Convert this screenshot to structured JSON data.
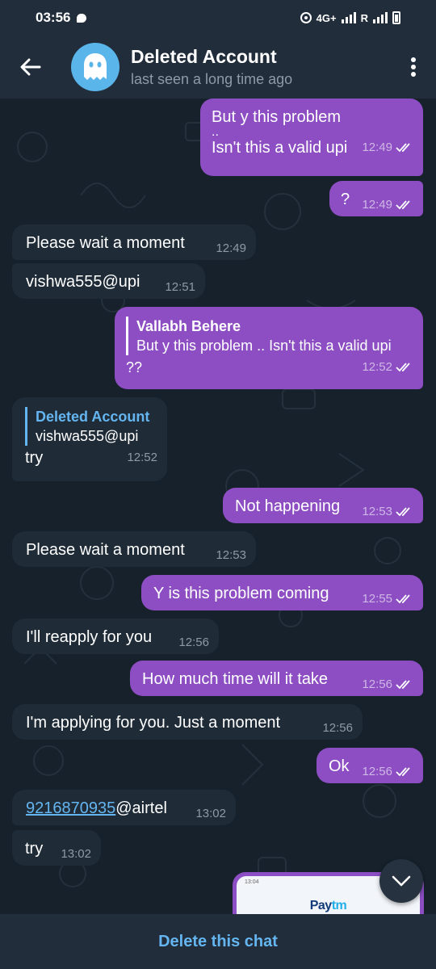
{
  "status_bar": {
    "time": "03:56",
    "network": "4G+",
    "roaming": "R"
  },
  "header": {
    "title": "Deleted Account",
    "subtitle": "last seen a long time ago"
  },
  "messages": [
    {
      "dir": "out",
      "lines": [
        "But y this problem",
        "..",
        "Isn't this a valid upi"
      ],
      "time": "12:49"
    },
    {
      "dir": "out",
      "text": "?",
      "time": "12:49"
    },
    {
      "dir": "in",
      "text": "Please wait a moment",
      "time": "12:49"
    },
    {
      "dir": "in",
      "text": "vishwa555@upi",
      "time": "12:51"
    },
    {
      "dir": "out",
      "reply_name": "Vallabh Behere",
      "reply_text": "But y this problem .. Isn't this a valid upi",
      "text": "??",
      "time": "12:52"
    },
    {
      "dir": "in",
      "reply_name": "Deleted Account",
      "reply_text": "vishwa555@upi",
      "text": "try",
      "time": "12:52"
    },
    {
      "dir": "out",
      "text": "Not happening",
      "time": "12:53"
    },
    {
      "dir": "in",
      "text": "Please wait a moment",
      "time": "12:53"
    },
    {
      "dir": "out",
      "text": "Y is this problem coming",
      "time": "12:55"
    },
    {
      "dir": "in",
      "text": "I'll reapply for you",
      "time": "12:56"
    },
    {
      "dir": "out",
      "text": "How much time will it take",
      "time": "12:56"
    },
    {
      "dir": "in",
      "text": "I'm applying for you. Just a moment",
      "time": "12:56"
    },
    {
      "dir": "out",
      "text": "Ok",
      "time": "12:56"
    },
    {
      "dir": "in",
      "link": "9216870935",
      "text": "@airtel",
      "time": "13:02"
    },
    {
      "dir": "in",
      "text": "try",
      "time": "13:02"
    }
  ],
  "preview": {
    "status_time": "13:04",
    "brand_a": "Pay",
    "brand_b": "tm"
  },
  "bottom": {
    "delete_label": "Delete this chat"
  },
  "colors": {
    "outgoing_bubble": "#8c4ec2",
    "incoming_bubble": "#1f2c38",
    "accent": "#64b5f0",
    "header": "#212d3b"
  }
}
